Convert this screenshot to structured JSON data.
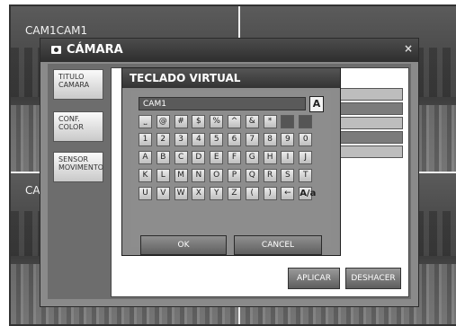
{
  "camera_labels": [
    "CAM1CAM1",
    "CA"
  ],
  "window": {
    "title": "CÁMARA",
    "close": "×",
    "sidebar": [
      {
        "line1": "TITULO",
        "line2": "CAMARA"
      },
      {
        "line1": "CONF.",
        "line2": "COLOR"
      },
      {
        "line1": "SENSOR",
        "line2": "MOVIMENTO"
      }
    ],
    "apply_label": "APLICAR",
    "undo_label": "DESHACER"
  },
  "keyboard": {
    "title": "TECLADO VIRTUAL",
    "input_value": "CAM1",
    "caps_label": "A",
    "rows": [
      [
        "⎵",
        "@",
        "#",
        "$",
        "%",
        "^",
        "&",
        "*",
        "",
        ""
      ],
      [
        "1",
        "2",
        "3",
        "4",
        "5",
        "6",
        "7",
        "8",
        "9",
        "0"
      ],
      [
        "A",
        "B",
        "C",
        "D",
        "E",
        "F",
        "G",
        "H",
        "I",
        "J"
      ],
      [
        "K",
        "L",
        "M",
        "N",
        "O",
        "P",
        "Q",
        "R",
        "S",
        "T"
      ],
      [
        "U",
        "V",
        "W",
        "X",
        "Y",
        "Z",
        "(",
        ")",
        "←",
        "A/a"
      ]
    ],
    "ok_label": "OK",
    "cancel_label": "CANCEL"
  }
}
